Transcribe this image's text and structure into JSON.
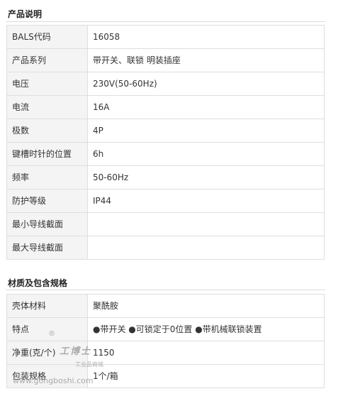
{
  "section1": {
    "title": "产品说明",
    "rows": [
      {
        "key": "BALS代码",
        "value": "16058"
      },
      {
        "key": "产品系列",
        "value": "带开关、联锁 明装插座"
      },
      {
        "key": "电压",
        "value": "230V(50-60Hz)"
      },
      {
        "key": "电流",
        "value": "16A"
      },
      {
        "key": "极数",
        "value": "4P"
      },
      {
        "key": "键槽时针的位置",
        "value": "6h"
      },
      {
        "key": "频率",
        "value": "50-60Hz"
      },
      {
        "key": "防护等级",
        "value": "IP44"
      },
      {
        "key": "最小导线截面",
        "value": ""
      },
      {
        "key": "最大导线截面",
        "value": ""
      }
    ]
  },
  "section2": {
    "title": "材质及包含规格",
    "rows": [
      {
        "key": "壳体材料",
        "value": "聚酰胺"
      },
      {
        "key": "特点",
        "value": "●带开关 ●可锁定于0位置 ●带机械联锁装置"
      },
      {
        "key": "净重(克/个)",
        "value": "1150"
      },
      {
        "key": "包装规格",
        "value": "1个/箱"
      }
    ]
  },
  "watermark": {
    "reg": "®",
    "brand": "工博士",
    "sub": "工业品商城",
    "url": "www.gongboshi.com"
  }
}
